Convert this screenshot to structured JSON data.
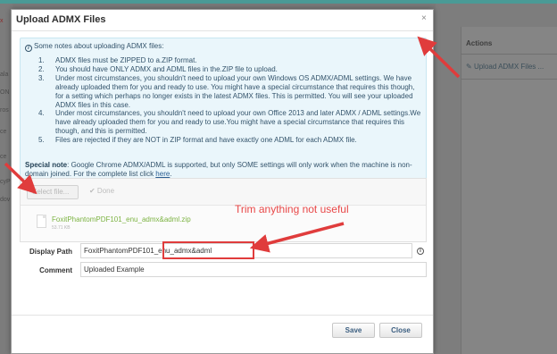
{
  "background": {
    "left_texts": [
      "x",
      "ala",
      "ON",
      "ros",
      "ce",
      "ce",
      "cyP",
      "dov"
    ],
    "actions_title": "Actions",
    "actions_link": "Upload ADMX Files ..."
  },
  "modal": {
    "title": "Upload ADMX Files",
    "close": "×"
  },
  "notes": {
    "icon": "info-icon",
    "heading": "Some notes about uploading ADMX files:",
    "items": [
      {
        "num": "1.",
        "text": "ADMX files must be ZIPPED to a.ZIP format."
      },
      {
        "num": "2.",
        "text": "You should have ONLY ADMX and ADML files in the.ZIP file to upload."
      },
      {
        "num": "3.",
        "text": "Under most circumstances, you shouldn't need to upload your own Windows OS ADMX/ADML settings. We have already uploaded them for you and ready to use. You might have a special circumstance that requires this though, for a setting which perhaps no longer exists in the latest ADMX files. This is permitted. You will see your uploaded ADMX files in this case."
      },
      {
        "num": "4.",
        "text": "Under most circumstances, you shouldn't need to upload your own Office 2013 and later ADMX / ADML settings.We have already uploaded them for you and ready to use.You might have a special circumstance that requires this though, and this is permitted."
      },
      {
        "num": "5.",
        "text": "Files are rejected if they are NOT in ZIP format and have exactly one ADML for each ADMX file."
      }
    ],
    "special_label": "Special note",
    "special_text": ": Google Chrome ADMX/ADML is supported, but only SOME settings will only work when the machine is non-domain joined. For the complete list click ",
    "special_link": "here",
    "special_end": "."
  },
  "upload": {
    "select_label": "Select file...",
    "done_label": "✔ Done",
    "file_name": "FoxitPhantomPDF101_enu_admx&adml.zip",
    "file_size": "53.71 KB"
  },
  "form": {
    "display_path_label": "Display Path",
    "display_path_value": "FoxitPhantomPDF101_enu_admx&adml",
    "comment_label": "Comment",
    "comment_value": "Uploaded Example"
  },
  "buttons": {
    "save": "Save",
    "close": "Close"
  },
  "annotation": {
    "text": "Trim anything not useful",
    "color": "#e03c3c"
  }
}
